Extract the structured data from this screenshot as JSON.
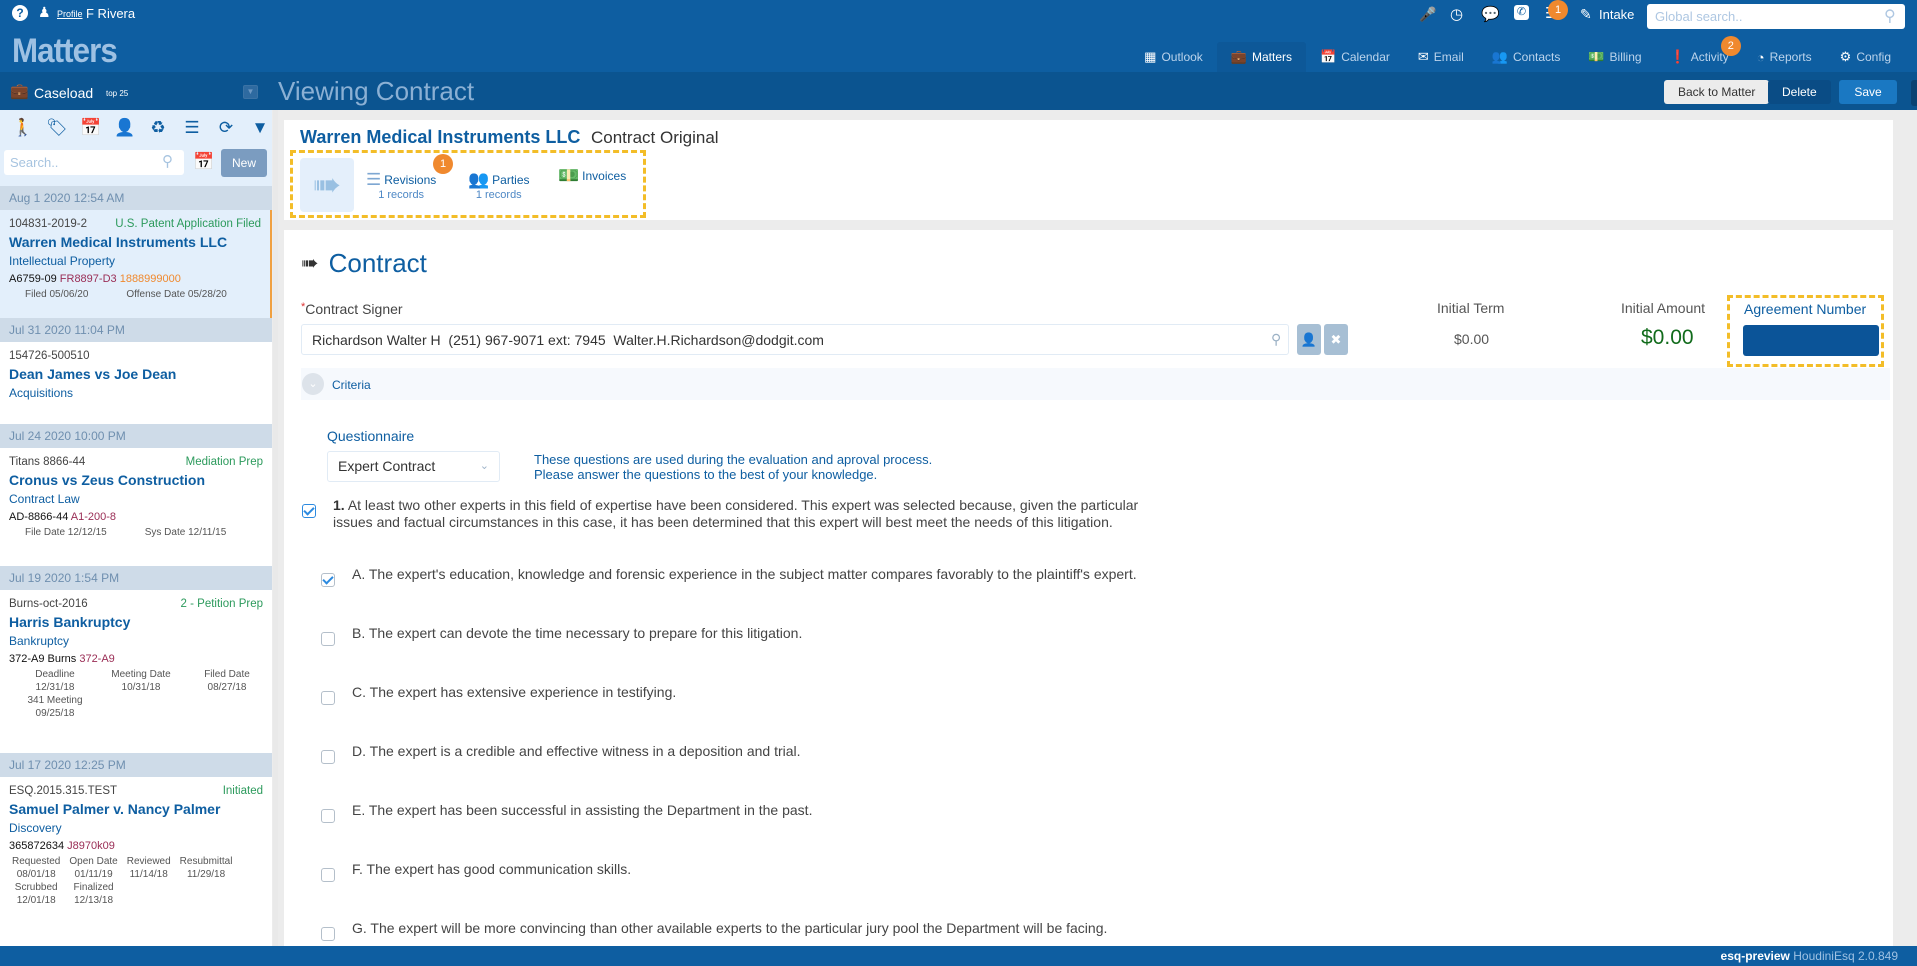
{
  "topbar": {
    "help_icon": "?",
    "profile_link": "Profile",
    "user_name": "F Rivera",
    "brand": "Matters",
    "notif_badge": "1",
    "intake_label": "Intake",
    "global_search_placeholder": "Global search.."
  },
  "nav": {
    "items": [
      {
        "label": "Outlook",
        "icon": "grid-icon"
      },
      {
        "label": "Matters",
        "icon": "briefcase-icon",
        "active": true
      },
      {
        "label": "Calendar",
        "icon": "calendar-icon"
      },
      {
        "label": "Email",
        "icon": "envelope-icon"
      },
      {
        "label": "Contacts",
        "icon": "users-icon"
      },
      {
        "label": "Billing",
        "icon": "money-icon"
      },
      {
        "label": "Activity",
        "icon": "exclamation-icon",
        "badge": "2"
      },
      {
        "label": "Reports",
        "icon": "pie-chart-icon"
      },
      {
        "label": "Config",
        "icon": "gears-icon"
      }
    ]
  },
  "subbar": {
    "caseload": "Caseload",
    "caseload_sub": "top 25",
    "view_title": "Viewing Contract",
    "back_label": "Back to Matter",
    "delete_label": "Delete",
    "save_label": "Save"
  },
  "sidebar": {
    "search_placeholder": "Search..",
    "new_label": "New",
    "cases": [
      {
        "date": "Aug 1 2020 12:54 AM",
        "number": "104831-2019-2",
        "status": "U.S. Patent Application Filed",
        "title": "Warren Medical Instruments LLC",
        "type": "Intellectual Property",
        "code1": "A6759-09",
        "code2": "FR8897-D3",
        "code3": "1888999000",
        "dates": [
          [
            "Filed 05/06/20"
          ],
          [
            "Offense Date 05/28/20"
          ]
        ]
      },
      {
        "date": "Jul 31 2020 11:04 PM",
        "number": "154726-500510",
        "status": "",
        "title": "Dean James vs Joe Dean",
        "type": "Acquisitions"
      },
      {
        "date": "Jul 24 2020 10:00 PM",
        "number": "Titans 8866-44",
        "status": "Mediation Prep",
        "title": "Cronus vs Zeus Construction",
        "type": "Contract Law",
        "code1": "AD-8866-44",
        "code2": "A1-200-8",
        "dates": [
          [
            "File Date 12/12/15"
          ],
          [
            "Sys Date 12/11/15"
          ]
        ]
      },
      {
        "date": "Jul 19 2020 1:54 PM",
        "number": "Burns-oct-2016",
        "status": "2 - Petition Prep",
        "title": "Harris Bankruptcy",
        "type": "Bankruptcy",
        "code1": "372-A9 Burns",
        "code2": "372-A9",
        "dates": [
          [
            "Deadline",
            "12/31/18"
          ],
          [
            "Meeting Date",
            "10/31/18"
          ],
          [
            "Filed Date",
            "08/27/18"
          ],
          [
            "341 Meeting",
            "09/25/18"
          ]
        ]
      },
      {
        "date": "Jul 17 2020 12:25 PM",
        "number": "ESQ.2015.315.TEST",
        "status": "Initiated",
        "title": "Samuel Palmer v. Nancy Palmer",
        "type": "Discovery",
        "code1": "365872634",
        "code2": "J8970k09",
        "dates": [
          [
            "Requested",
            "08/01/18"
          ],
          [
            "Open Date",
            "01/11/19"
          ],
          [
            "Reviewed",
            "11/14/18"
          ],
          [
            "Resubmittal",
            "11/29/18"
          ],
          [
            "Scrubbed",
            "12/01/18"
          ],
          [
            "Finalized",
            "12/13/18"
          ]
        ]
      }
    ]
  },
  "header": {
    "title": "Warren Medical Instruments LLC",
    "subtitle": "Contract Original",
    "tabs": [
      {
        "label": "Revisions",
        "records": "1 records",
        "badge": "1"
      },
      {
        "label": "Parties",
        "records": "1 records"
      },
      {
        "label": "Invoices",
        "records": ""
      }
    ]
  },
  "contract": {
    "heading": "Contract",
    "signer_label": "Contract Signer",
    "signer_required": "*",
    "signer_value": "Richardson Walter H  (251) 967-9071 ext: 7945  Walter.H.Richardson@dodgit.com",
    "initial_term_label": "Initial Term",
    "initial_term_value": "$0.00",
    "initial_amount_label": "Initial Amount",
    "initial_amount_value": "$0.00",
    "agreement_number_label": "Agreement Number",
    "agreement_number_value": "",
    "criteria_label": "Criteria",
    "questionnaire_label": "Questionnaire",
    "questionnaire_value": "Expert Contract",
    "help_line1": "These questions are used during the evaluation and aproval process.",
    "help_line2": "Please answer the questions to the best of your knowledge.",
    "main_question": {
      "num": "1.",
      "line1": "At least two other experts in this field of expertise have been considered. This expert was selected because, given the particular",
      "line2": "issues and factual circumstances in this case, it has been determined that this expert will best meet the needs of this litigation.",
      "checked": true
    },
    "sub_questions": [
      {
        "letter": "A.",
        "text": "The expert's education, knowledge and forensic experience in the subject matter compares favorably to the plaintiff's expert.",
        "checked": true
      },
      {
        "letter": "B.",
        "text": "The expert can devote the time necessary to prepare for this litigation.",
        "checked": false
      },
      {
        "letter": "C.",
        "text": "The expert has extensive experience in testifying.",
        "checked": false
      },
      {
        "letter": "D.",
        "text": "The expert is a credible and effective witness in a deposition and trial.",
        "checked": false
      },
      {
        "letter": "E.",
        "text": "The expert has been successful in assisting the Department in the past.",
        "checked": false
      },
      {
        "letter": "F.",
        "text": "The expert has good communication skills.",
        "checked": false
      },
      {
        "letter": "G.",
        "text": "The expert will be more convincing than other available experts to the particular jury pool the Department will be facing.",
        "checked": false
      }
    ]
  },
  "footer": {
    "env": "esq-preview",
    "version": "HoudiniEsq 2.0.849"
  }
}
